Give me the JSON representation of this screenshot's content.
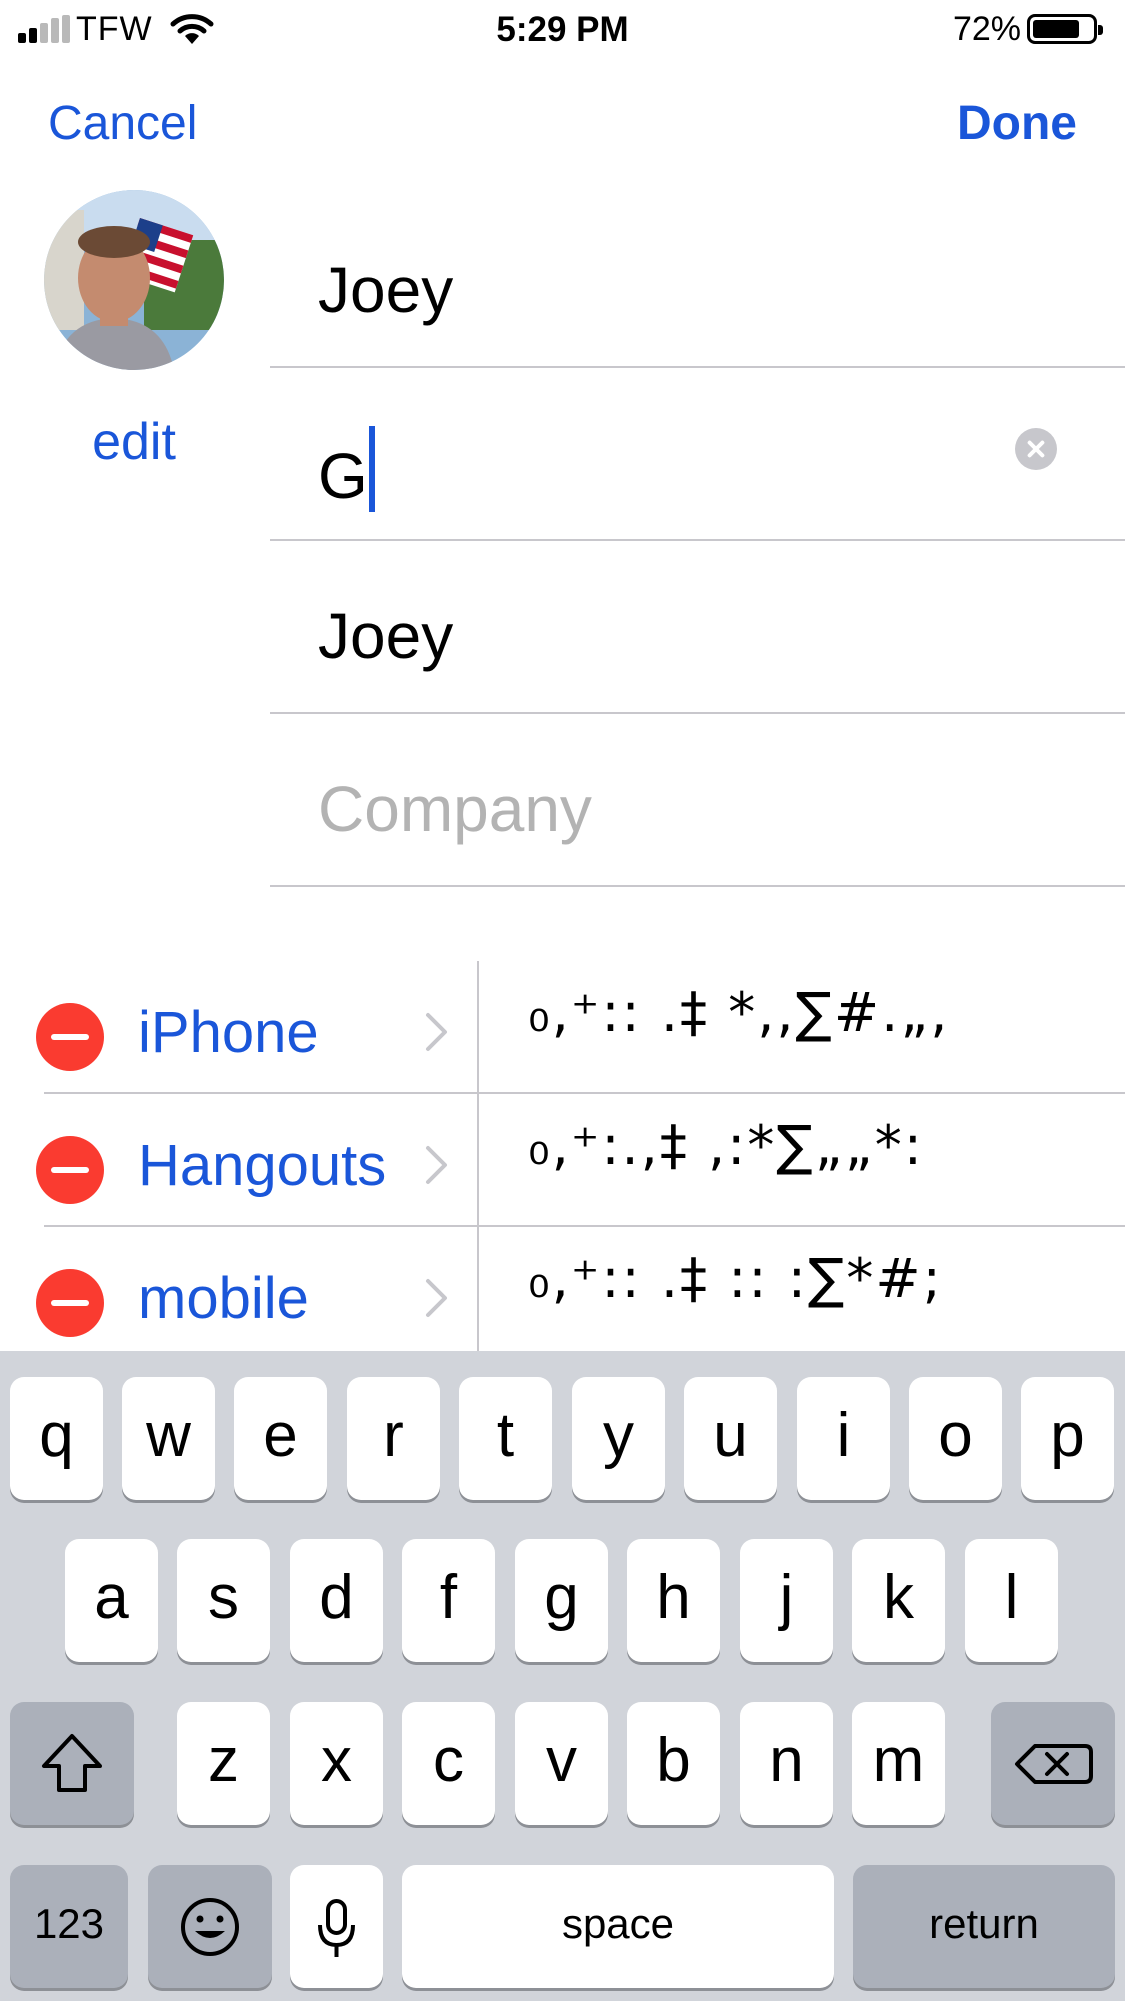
{
  "status_bar": {
    "carrier": "TFW",
    "time": "5:29 PM",
    "battery": "72%"
  },
  "nav": {
    "cancel_label": "Cancel",
    "done_label": "Done"
  },
  "avatar": {
    "edit_label": "edit"
  },
  "fields": {
    "first_name": "Joey",
    "last_name": "G",
    "nickname": "Joey",
    "company_placeholder": "Company"
  },
  "phones": [
    {
      "label": "iPhone",
      "value": "₀,⁺:: .‡ *,,∑#.„,"
    },
    {
      "label": "Hangouts",
      "value": "₀,⁺:.,‡ ,:*∑„„*:"
    },
    {
      "label": "mobile",
      "value": "₀,⁺:: .‡ :: :∑*#;"
    }
  ],
  "keyboard": {
    "row1": [
      "q",
      "w",
      "e",
      "r",
      "t",
      "y",
      "u",
      "i",
      "o",
      "p"
    ],
    "row2": [
      "a",
      "s",
      "d",
      "f",
      "g",
      "h",
      "j",
      "k",
      "l"
    ],
    "row3": [
      "z",
      "x",
      "c",
      "v",
      "b",
      "n",
      "m"
    ],
    "numbers_label": "123",
    "space_label": "space",
    "return_label": "return"
  },
  "colors": {
    "accent": "#1a56d9",
    "delete_red": "#fa3b30",
    "keyboard_bg": "#d1d4da"
  }
}
